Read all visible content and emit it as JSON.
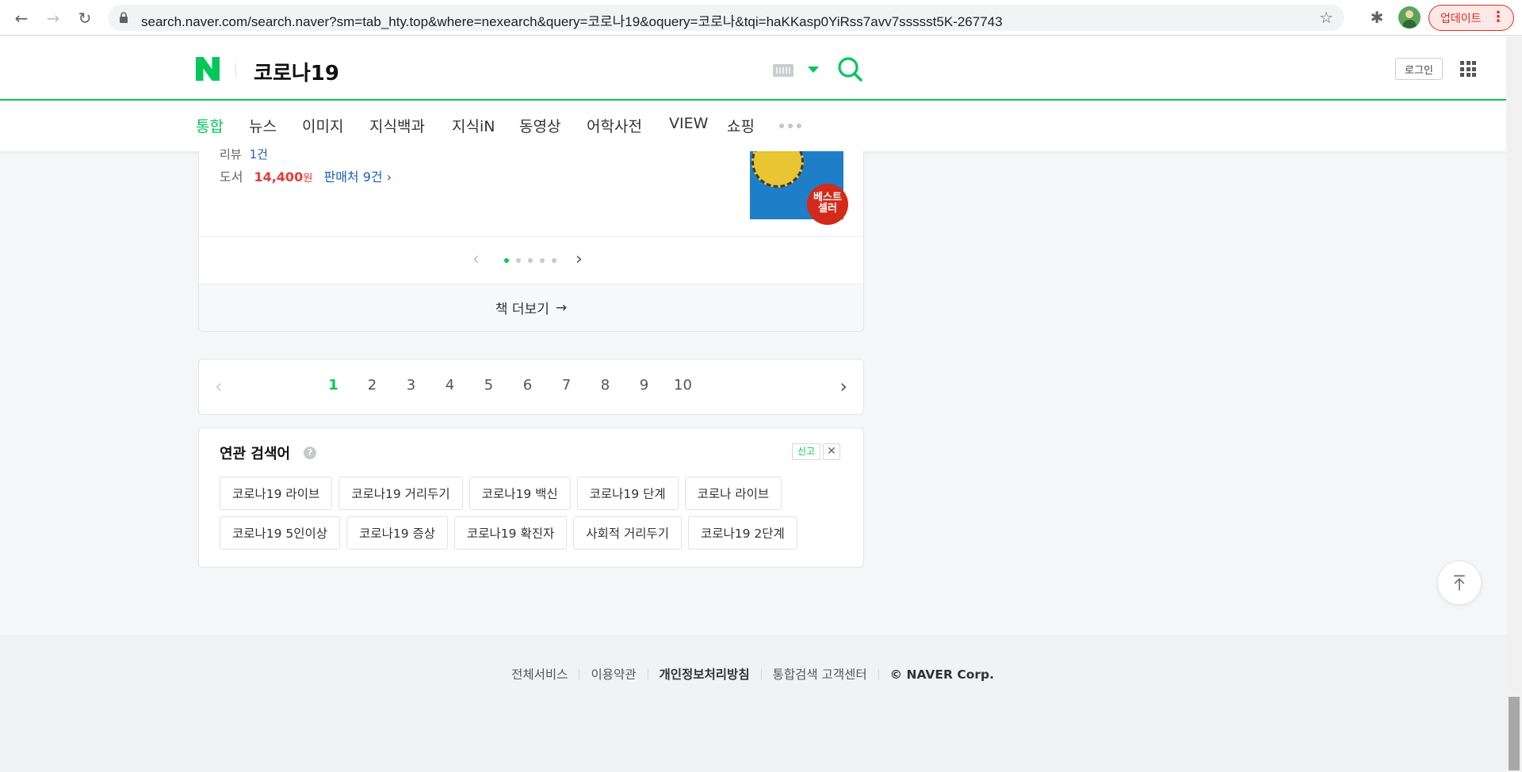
{
  "browser": {
    "url": "search.naver.com/search.naver?sm=tab_hty.top&where=nexearch&query=코로나19&oquery=코로나&tqi=haKKasp0YiRss7avv7ssssst5K-267743",
    "update_label": "업데이트"
  },
  "header": {
    "query": "코로나19",
    "login_label": "로그인"
  },
  "tabs": [
    {
      "label": "통합",
      "active": true
    },
    {
      "label": "뉴스"
    },
    {
      "label": "이미지"
    },
    {
      "label": "지식백과"
    },
    {
      "label": "지식iN"
    },
    {
      "label": "동영상"
    },
    {
      "label": "어학사전"
    },
    {
      "label": "VIEW"
    },
    {
      "label": "쇼핑"
    }
  ],
  "book": {
    "review_label": "리뷰",
    "review_value": "1건",
    "type_label": "도서",
    "price_value": "14,400",
    "price_unit": "원",
    "sellers": "판매처 9건",
    "badge_line1": "베스트",
    "badge_line2": "셀러",
    "carousel_pages": 5,
    "carousel_current": 1,
    "more_label": "책 더보기"
  },
  "pagination": {
    "pages": [
      "1",
      "2",
      "3",
      "4",
      "5",
      "6",
      "7",
      "8",
      "9",
      "10"
    ],
    "current": "1"
  },
  "related": {
    "title": "연관 검색어",
    "report_label": "신고",
    "keywords": [
      "코로나19 라이브",
      "코로나19 거리두기",
      "코로나19 백신",
      "코로나19 단계",
      "코로나 라이브",
      "코로나19 5인이상",
      "코로나19 증상",
      "코로나19 확진자",
      "사회적 거리두기",
      "코로나19 2단계"
    ]
  },
  "footer": {
    "links": [
      "전체서비스",
      "이용약관",
      "개인정보처리방침",
      "통합검색 고객센터"
    ],
    "copyright": "© NAVER Corp."
  },
  "colors": {
    "brand_green": "#03c75a",
    "price_red": "#e63b3b",
    "link_blue": "#1a5eb5"
  }
}
